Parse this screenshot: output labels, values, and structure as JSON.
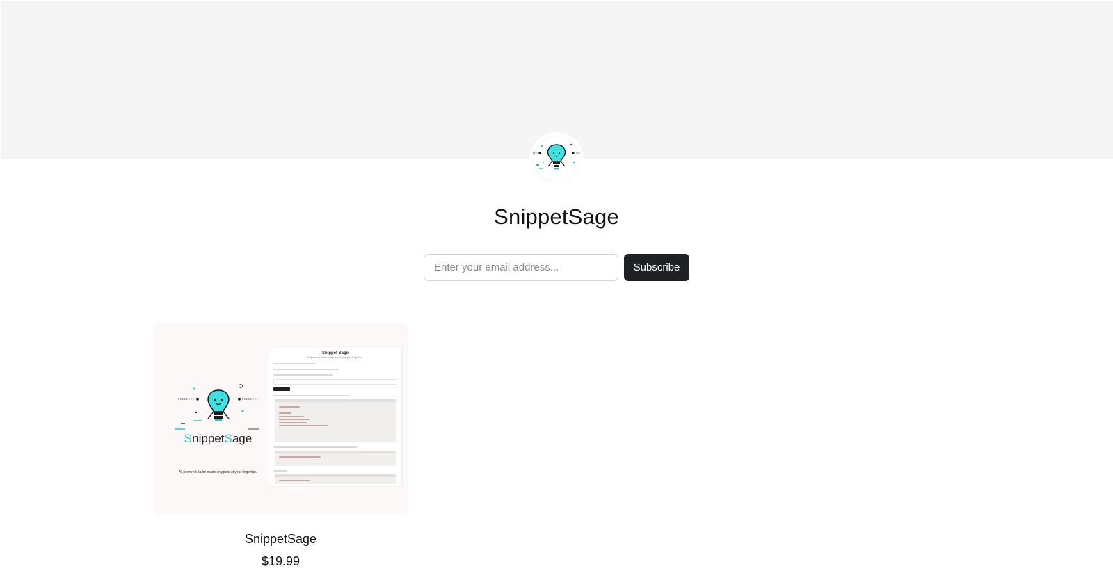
{
  "store": {
    "title": "SnippetSage"
  },
  "subscribe": {
    "placeholder": "Enter your email address...",
    "button_label": "Subscribe"
  },
  "products": [
    {
      "name": "SnippetSage",
      "price": "$19.99",
      "thumbnail": {
        "wordmark_start": "S",
        "wordmark_mid": "nippet",
        "wordmark_accent": "S",
        "wordmark_end": "age",
        "tagline": "AI-powered, tailor-made snippets at your fingertips.",
        "screenshot_title": "Snippet Sage",
        "screenshot_subtitle": "AI-powered, tailor-made snippets at your fingertips."
      }
    }
  ],
  "colors": {
    "cover_background": "#f5f5f5",
    "accent": "#2ec4c4",
    "button_dark": "#1f2125"
  }
}
